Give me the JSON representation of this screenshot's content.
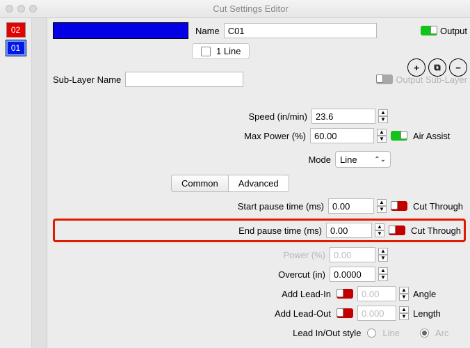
{
  "window": {
    "title": "Cut Settings Editor"
  },
  "sidebar": {
    "layers": [
      {
        "label": "02",
        "color": "red"
      },
      {
        "label": "01",
        "color": "blue",
        "selected": true
      }
    ]
  },
  "header": {
    "name_label": "Name",
    "name_value": "C01",
    "output_label": "Output",
    "one_line_label": "1 Line",
    "sub_layer_label": "Sub-Layer Name",
    "sub_layer_value": "",
    "output_sublayer_label": "Output Sub-Layer"
  },
  "icon_btns": {
    "plus": "+",
    "copy": "⧉",
    "minus": "−"
  },
  "params": {
    "speed": {
      "label": "Speed (in/min)",
      "value": "23.6"
    },
    "max_power": {
      "label": "Max Power (%)",
      "value": "60.00",
      "air_assist": "Air Assist"
    },
    "mode": {
      "label": "Mode",
      "value": "Line"
    }
  },
  "tabs": {
    "common": "Common",
    "advanced": "Advanced"
  },
  "advanced": {
    "start_pause": {
      "label": "Start pause time (ms)",
      "value": "0.00",
      "cut": "Cut Through"
    },
    "end_pause": {
      "label": "End pause time (ms)",
      "value": "0.00",
      "cut": "Cut Through"
    },
    "power": {
      "label": "Power (%)",
      "value": "0.00"
    },
    "overcut": {
      "label": "Overcut (in)",
      "value": "0.0000"
    },
    "lead_in": {
      "label": "Add Lead-In",
      "value": "0.00",
      "after": "Angle"
    },
    "lead_out": {
      "label": "Add Lead-Out",
      "value": "0.000",
      "after": "Length"
    },
    "style": {
      "label": "Lead In/Out style",
      "opt1": "Line",
      "opt2": "Arc"
    }
  }
}
